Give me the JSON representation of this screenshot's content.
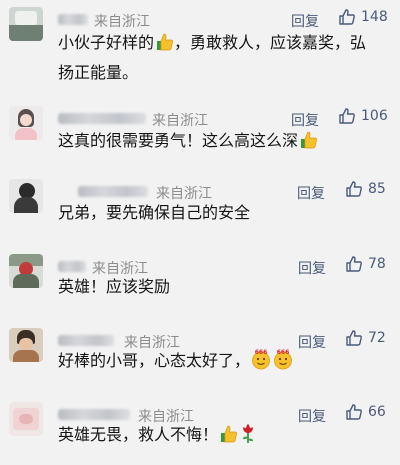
{
  "comments": [
    {
      "location": "来自浙江",
      "reply": "回复",
      "likes": "148",
      "text1": "小伙子好样的",
      "text2": "，勇敢救人，应该嘉奖，弘",
      "text3": "扬正能量。",
      "emojis": [
        "thumbs-up"
      ]
    },
    {
      "location": "来自浙江",
      "reply": "回复",
      "likes": "106",
      "text1": "这真的很需要勇气！这么高这么深",
      "emojis": [
        "thumbs-up"
      ]
    },
    {
      "location": "来自浙江",
      "reply": "回复",
      "likes": "85",
      "text1": "兄弟，要先确保自己的安全",
      "emojis": []
    },
    {
      "location": "来自浙江",
      "reply": "回复",
      "likes": "78",
      "text1": "英雄！应该奖励",
      "emojis": []
    },
    {
      "location": "来自浙江",
      "reply": "回复",
      "likes": "72",
      "text1": "好棒的小哥，心态太好了，",
      "emojis": [
        "666-face",
        "666-face"
      ]
    },
    {
      "location": "来自浙江",
      "reply": "回复",
      "likes": "66",
      "text1": "英雄无畏，救人不悔！",
      "emojis": [
        "thumbs-up",
        "rose"
      ]
    }
  ],
  "colors": {
    "background": "#f2f2f2",
    "name_text": "#4a5b7a",
    "location_text": "#8c8c8c",
    "body_text": "#151515",
    "emoji_yellow": "#f6c12a"
  },
  "icons": {
    "like": "thumbs-up-outline-icon"
  }
}
